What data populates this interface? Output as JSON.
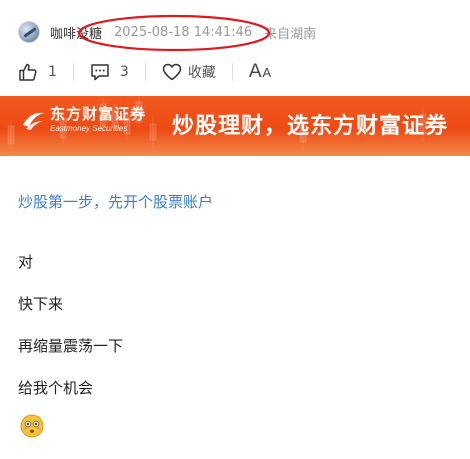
{
  "author": {
    "name": "咖啡没糖",
    "time": "2025-08-18 14:41:46",
    "location": "来自湖南"
  },
  "actions": {
    "like_count": "1",
    "comment_count": "3",
    "favorite_label": "收藏",
    "font_big": "A",
    "font_small": "A"
  },
  "banner": {
    "brand_cn": "东方财富证券",
    "brand_en": "Eastmoney Securities",
    "slogan": "炒股理财，选东方财富证券",
    "colors": {
      "primary": "#ee4a14",
      "highlight_ellipse": "#e0191f"
    }
  },
  "promo_link": "炒股第一步，先开个股票账户",
  "comments": [
    "对",
    "快下来",
    "再缩量震荡一下",
    "给我个机会"
  ],
  "icons": [
    "like-icon",
    "comment-icon",
    "heart-icon",
    "font-size-icon",
    "eastmoney-logo-icon",
    "flushed-face-emoji-icon"
  ],
  "link_color": "#3a7fd0"
}
